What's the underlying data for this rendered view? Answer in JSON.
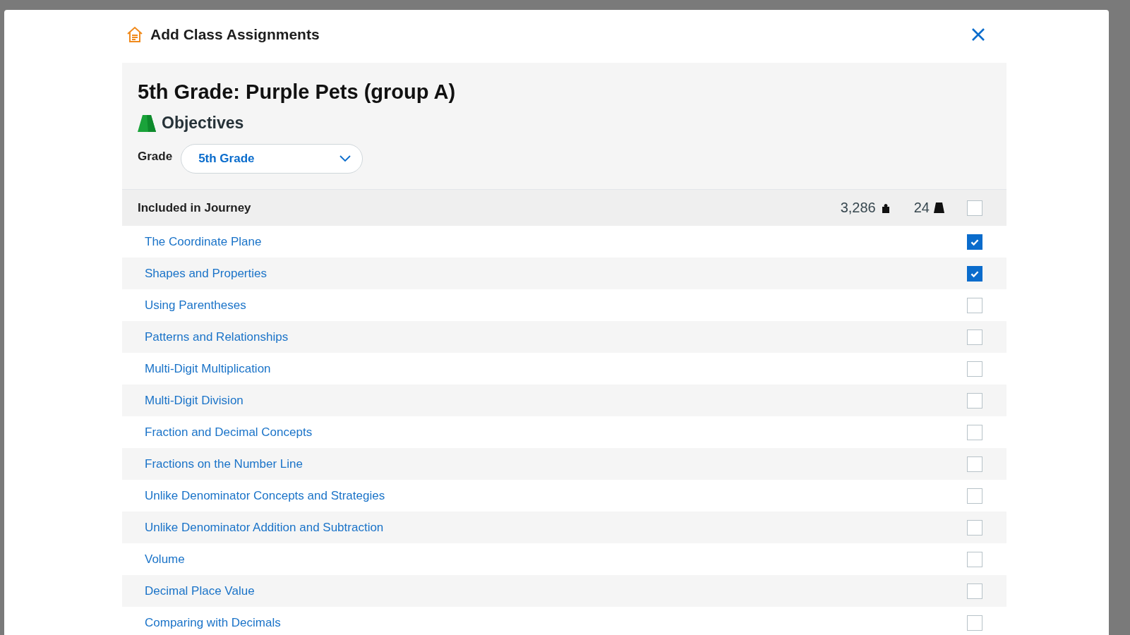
{
  "dialog": {
    "title": "Add Class Assignments"
  },
  "class_name": "5th Grade: Purple Pets (group A)",
  "section": "Objectives",
  "grade": {
    "label": "Grade",
    "value": "5th Grade"
  },
  "header": {
    "label": "Included in Journey",
    "count_1": "3,286",
    "count_2": "24",
    "checked": false
  },
  "objectives": [
    {
      "name": "The Coordinate Plane",
      "checked": true
    },
    {
      "name": "Shapes and Properties",
      "checked": true
    },
    {
      "name": "Using Parentheses",
      "checked": false
    },
    {
      "name": "Patterns and Relationships",
      "checked": false
    },
    {
      "name": "Multi-Digit Multiplication",
      "checked": false
    },
    {
      "name": "Multi-Digit Division",
      "checked": false
    },
    {
      "name": "Fraction and Decimal Concepts",
      "checked": false
    },
    {
      "name": "Fractions on the Number Line",
      "checked": false
    },
    {
      "name": "Unlike Denominator Concepts and Strategies",
      "checked": false
    },
    {
      "name": "Unlike Denominator Addition and Subtraction",
      "checked": false
    },
    {
      "name": "Volume",
      "checked": false
    },
    {
      "name": "Decimal Place Value",
      "checked": false
    },
    {
      "name": "Comparing with Decimals",
      "checked": false
    }
  ]
}
